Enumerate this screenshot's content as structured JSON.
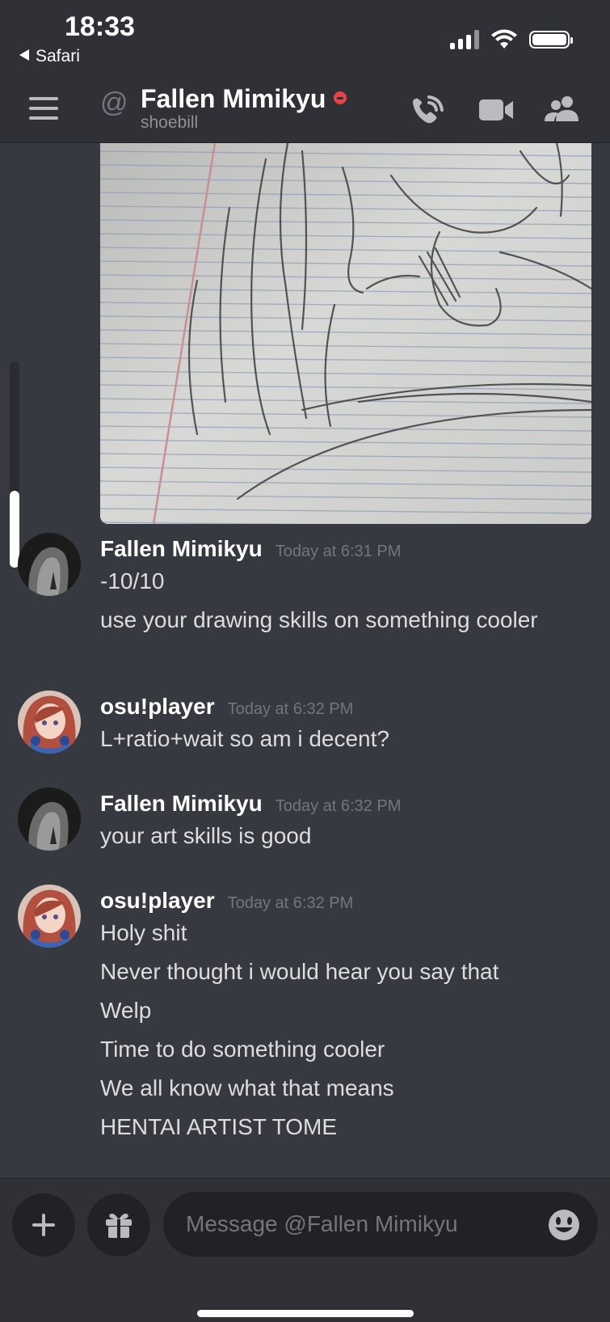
{
  "status_bar": {
    "time": "18:33",
    "back_app": "Safari"
  },
  "header": {
    "at_symbol": "@",
    "channel_name": "Fallen Mimikyu",
    "subtitle": "shoebill",
    "status": "do-not-disturb",
    "icons": [
      "menu-icon",
      "voice-call-icon",
      "video-call-icon",
      "members-icon"
    ]
  },
  "messages": [
    {
      "author": "Fallen Mimikyu",
      "timestamp": "Today at 6:31 PM",
      "lines": [
        "-10/10",
        "use your drawing skills on something cooler"
      ]
    },
    {
      "author": "osu!player",
      "timestamp": "Today at 6:32 PM",
      "lines": [
        "L+ratio+wait so am i decent?"
      ]
    },
    {
      "author": "Fallen Mimikyu",
      "timestamp": "Today at 6:32 PM",
      "lines": [
        "your art skills is good"
      ]
    },
    {
      "author": "osu!player",
      "timestamp": "Today at 6:32 PM",
      "lines": [
        "Holy shit",
        "Never thought i would hear you say that",
        "Welp",
        "Time to do something cooler",
        "We all know what that means",
        "HENTAI ARTIST TOME"
      ]
    }
  ],
  "composer": {
    "placeholder": "Message @Fallen Mimikyu",
    "icons": [
      "plus-icon",
      "gift-icon",
      "emoji-icon"
    ]
  },
  "colors": {
    "background": "#36393f",
    "header": "#2f3136",
    "input": "#202225",
    "dnd_red": "#ed4245",
    "timestamp": "#72767d"
  }
}
